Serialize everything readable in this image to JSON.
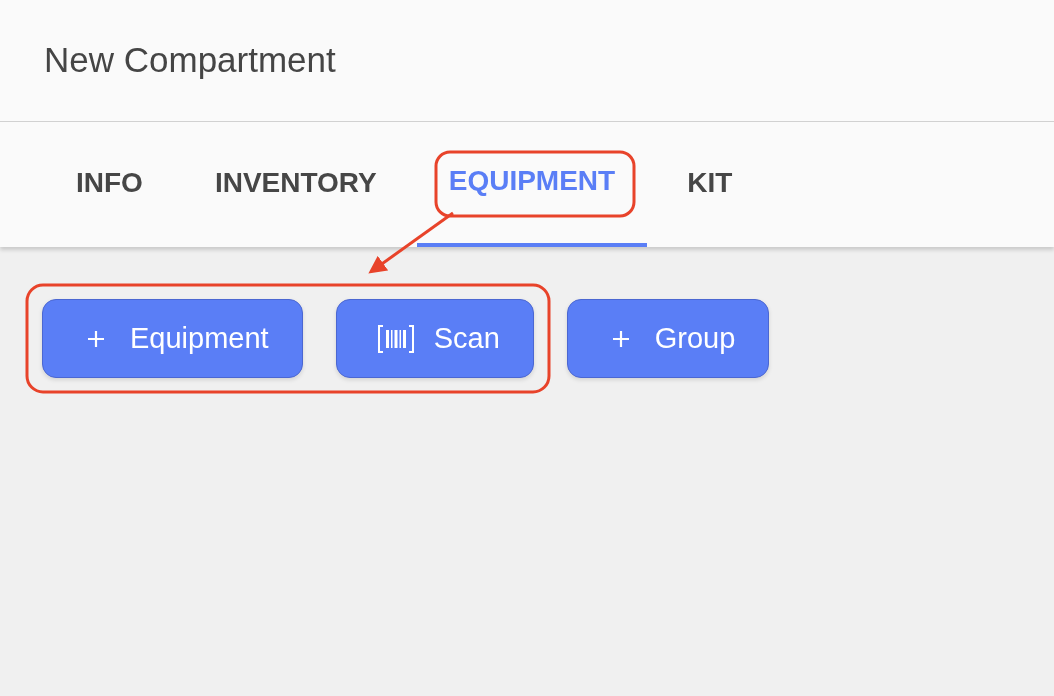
{
  "header": {
    "title": "New Compartment"
  },
  "tabs": [
    {
      "label": "INFO",
      "selected": false
    },
    {
      "label": "INVENTORY",
      "selected": false
    },
    {
      "label": "EQUIPMENT",
      "selected": true
    },
    {
      "label": "KIT",
      "selected": false
    }
  ],
  "actions": [
    {
      "kind": "add",
      "label": "Equipment"
    },
    {
      "kind": "scan",
      "label": "Scan"
    },
    {
      "kind": "add",
      "label": "Group"
    }
  ]
}
